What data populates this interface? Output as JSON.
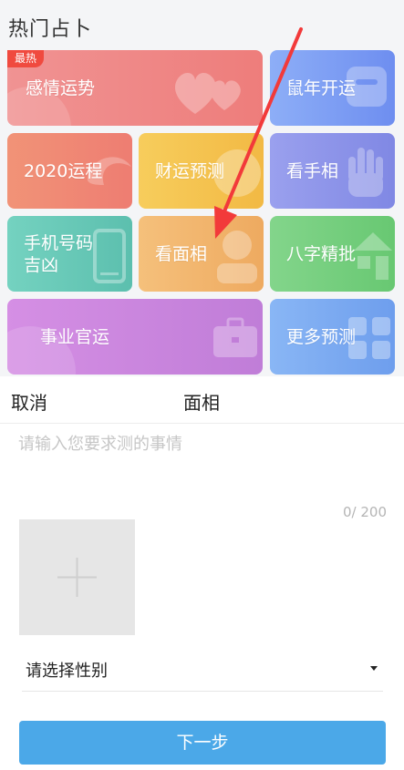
{
  "section_title": "热门占卜",
  "tiles": [
    {
      "label": "感情运势",
      "badge": "最热",
      "icon": "hearts-icon",
      "color": "#f07e7e"
    },
    {
      "label": "鼠年开运",
      "icon": "rat-icon",
      "color": "#7d9df5"
    },
    {
      "label": "2020运程",
      "icon": "swirl-icon",
      "color": "#f08a73"
    },
    {
      "label": "财运预测",
      "icon": "coin-icon",
      "color": "#f5c24e"
    },
    {
      "label": "看手相",
      "icon": "palm-icon",
      "color": "#8e95ea"
    },
    {
      "label": "手机号码\n吉凶",
      "icon": "phone-icon",
      "color": "#66c9b7"
    },
    {
      "label": "看面相",
      "icon": "person-icon",
      "color": "#f2b56a"
    },
    {
      "label": "八字精批",
      "icon": "destiny-char-icon",
      "color": "#74cf7c"
    },
    {
      "label": "事业官运",
      "icon": "briefcase-icon",
      "color": "#c98be0"
    },
    {
      "label": "更多预测",
      "icon": "grid-icon",
      "color": "#78a9f3"
    }
  ],
  "sheet": {
    "cancel_label": "取消",
    "title": "面相",
    "input_placeholder": "请输入您要求测的事情",
    "input_value": "",
    "counter": "0/ 200",
    "upload_icon": "plus-icon",
    "gender_select": {
      "value": "请选择性别",
      "icon": "caret-down-icon"
    },
    "next_label": "下一步"
  },
  "annotation": {
    "type": "arrow",
    "color": "#f23a3a"
  }
}
